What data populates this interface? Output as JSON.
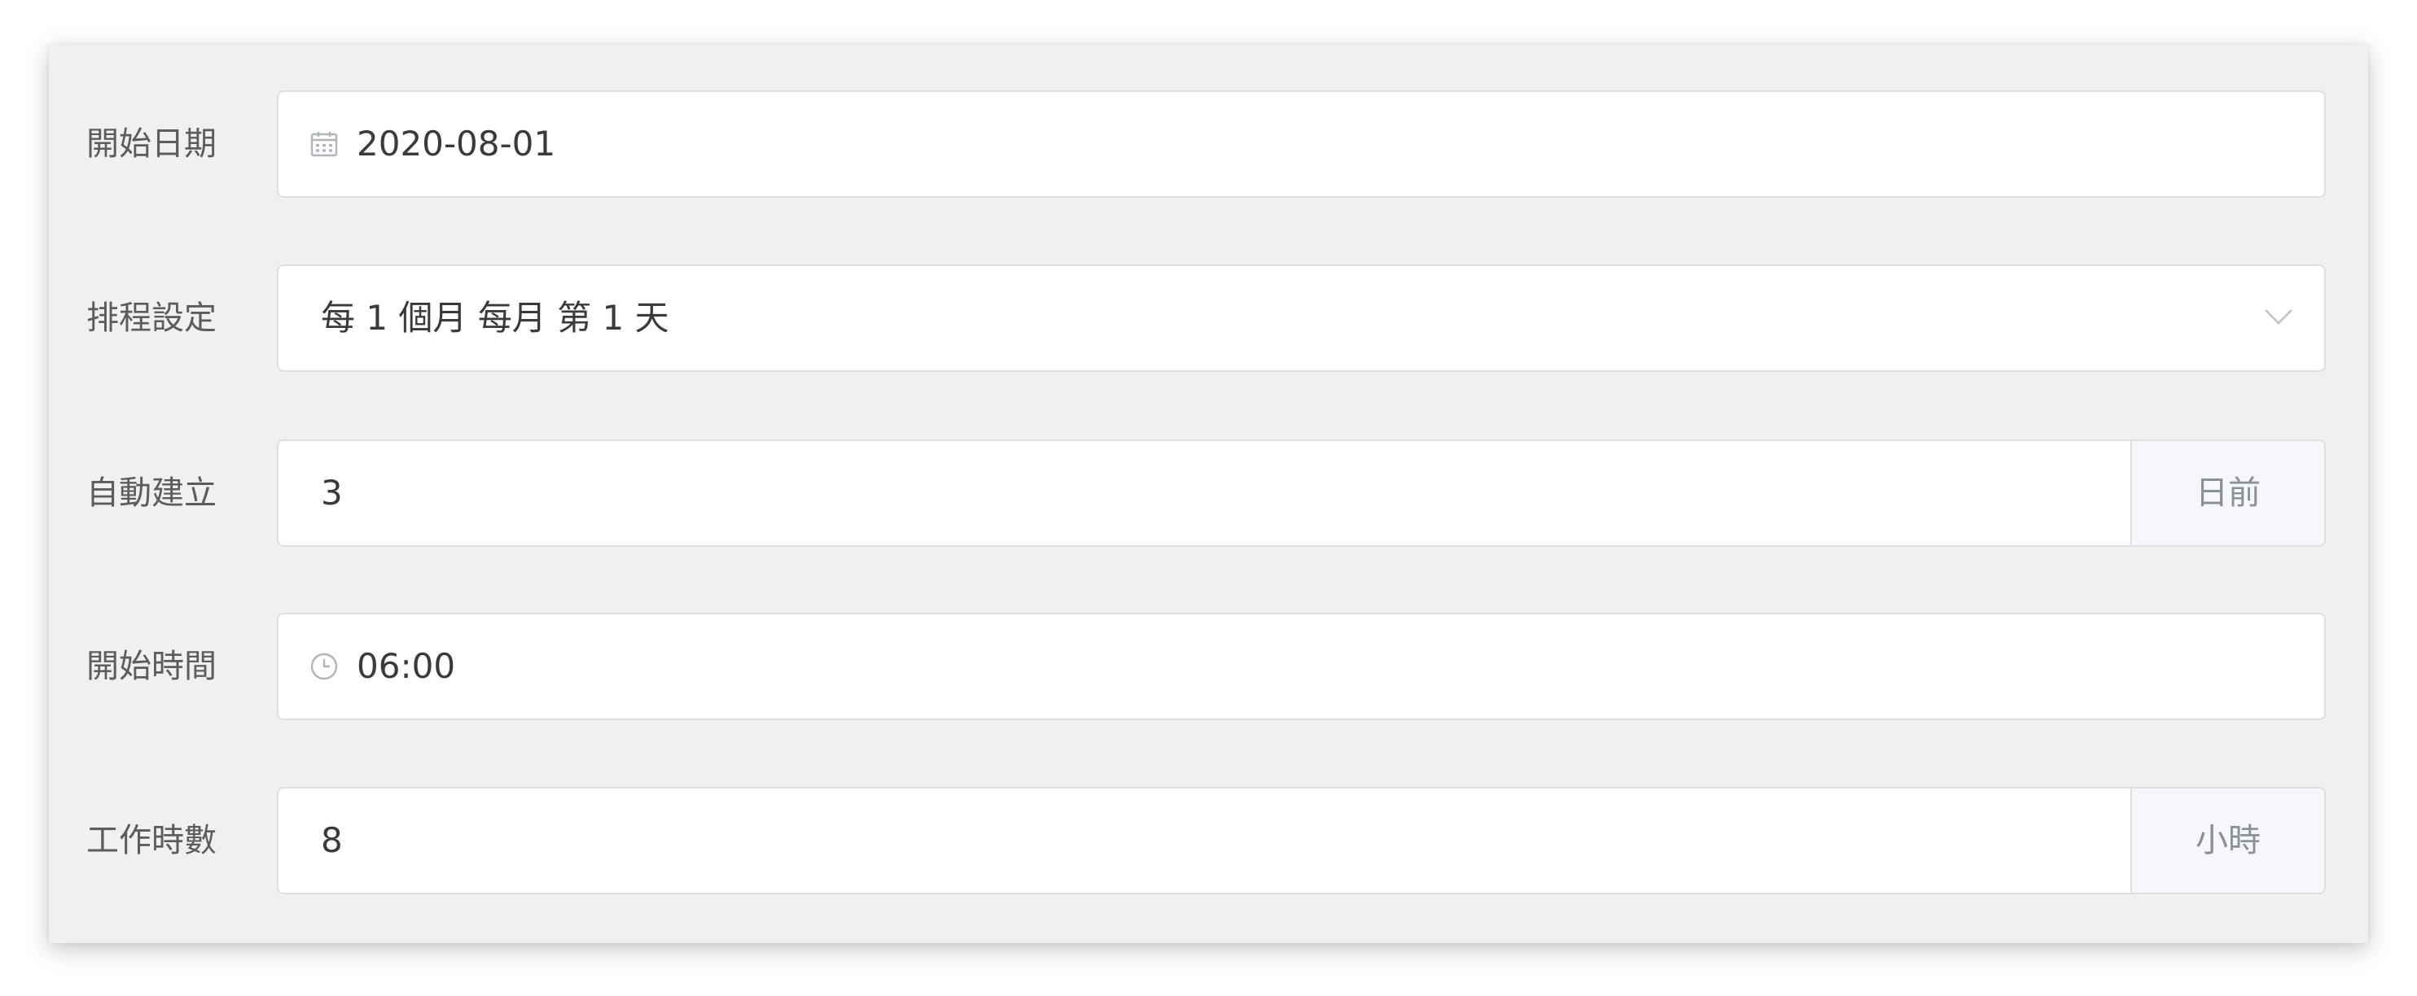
{
  "form": {
    "start_date": {
      "label": "開始日期",
      "value": "2020-08-01",
      "icon": "calendar-icon"
    },
    "schedule": {
      "label": "排程設定",
      "value": "每 1 個月 每月 第 1 天",
      "icon": "chevron-down-icon"
    },
    "auto_create": {
      "label": "自動建立",
      "value": "3",
      "unit": "日前"
    },
    "start_time": {
      "label": "開始時間",
      "value": "06:00",
      "icon": "clock-icon"
    },
    "work_hours": {
      "label": "工作時數",
      "value": "8",
      "unit": "小時"
    }
  }
}
